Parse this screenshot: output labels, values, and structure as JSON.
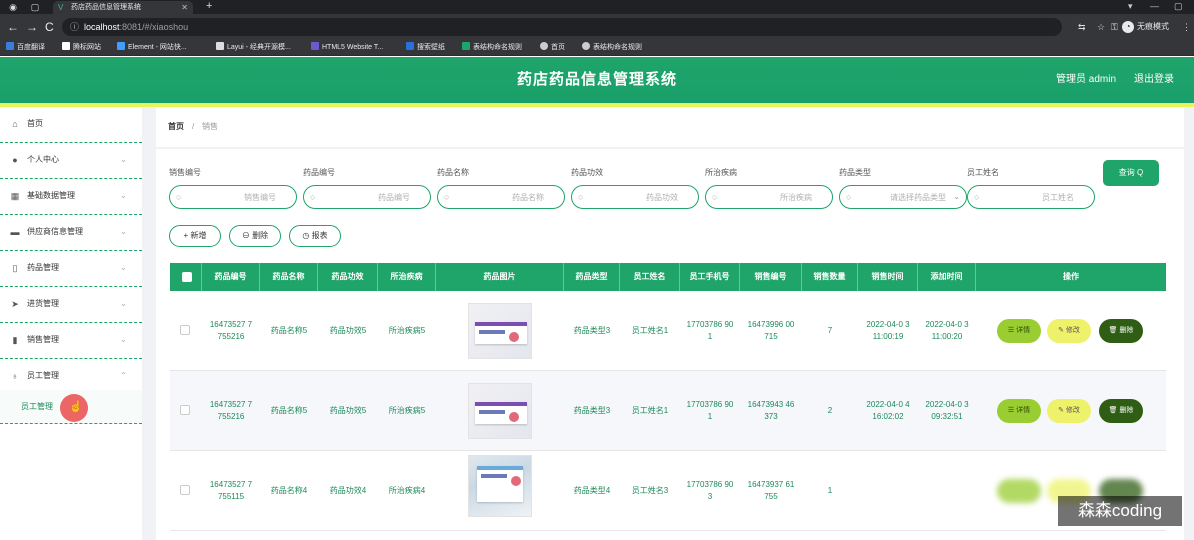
{
  "browser": {
    "tab_title": "药店药品信息管理系统",
    "url_host": "localhost",
    "url_path": ":8081/#/xiaoshou",
    "profile_label": "无痕模式",
    "bookmarks": [
      {
        "label": "百度翻译",
        "color": "#3b7ddd"
      },
      {
        "label": "腾标网站",
        "color": "#ffffff"
      },
      {
        "label": "Element - 网站快...",
        "color": "#409eff"
      },
      {
        "label": "Layui - 经典开源模...",
        "color": "#dddddd"
      },
      {
        "label": "HTML5 Website T...",
        "color": "#6a5acd"
      },
      {
        "label": "搜索壁纸",
        "color": "#2a6fdb"
      },
      {
        "label": "表结构命名规则",
        "color": "#1fa46a"
      },
      {
        "label": "首页",
        "color": "#cccccc"
      },
      {
        "label": "表结构命名规则",
        "color": "#cccccc"
      }
    ]
  },
  "header": {
    "title": "药店药品信息管理系统",
    "admin": "管理员 admin",
    "logout": "退出登录",
    "accent": "#1fa46a",
    "stripe": "#e9f45a"
  },
  "sidebar": {
    "items": [
      {
        "label": "首页",
        "icon": "home-icon"
      },
      {
        "label": "个人中心",
        "icon": "user-icon"
      },
      {
        "label": "基础数据管理",
        "icon": "grid-icon"
      },
      {
        "label": "供应商信息管理",
        "icon": "monitor-icon"
      },
      {
        "label": "药品管理",
        "icon": "phone-icon"
      },
      {
        "label": "进货管理",
        "icon": "send-icon"
      },
      {
        "label": "销售管理",
        "icon": "chart-icon"
      },
      {
        "label": "员工管理",
        "icon": "mic-icon"
      }
    ],
    "submenu_label": "员工管理"
  },
  "breadcrumb": {
    "home": "首页",
    "sep": "/",
    "current": "销售"
  },
  "search": {
    "fields": [
      {
        "label": "销售编号",
        "placeholder": "销售编号"
      },
      {
        "label": "药品编号",
        "placeholder": "药品编号"
      },
      {
        "label": "药品名称",
        "placeholder": "药品名称"
      },
      {
        "label": "药品功效",
        "placeholder": "药品功效"
      },
      {
        "label": "所治疾病",
        "placeholder": "所治疾病"
      },
      {
        "label": "药品类型",
        "placeholder": "请选择药品类型"
      },
      {
        "label": "员工姓名",
        "placeholder": "员工姓名"
      }
    ],
    "query_label": "查询 Q"
  },
  "actions": {
    "add": "+ 新增",
    "delete": "⊖ 删除",
    "report": "◷ 报表"
  },
  "table": {
    "headers": [
      "药品编号",
      "药品名称",
      "药品功效",
      "所治疾病",
      "药品图片",
      "药品类型",
      "员工姓名",
      "员工手机号",
      "销售编号",
      "销售数量",
      "销售时间",
      "添加时间",
      "操作"
    ],
    "rows": [
      {
        "code": "16473527 7755216",
        "name": "药品名称5",
        "effect": "药品功效5",
        "disease": "所治疾病5",
        "type": "药品类型3",
        "staff": "员工姓名1",
        "phone": "17703786 901",
        "sale_no": "16473996 00715",
        "qty": "7",
        "sale_time": "2022-04-0 3 11:00:19",
        "add_time": "2022-04-0 3 11:00:20"
      },
      {
        "code": "16473527 7755216",
        "name": "药品名称5",
        "effect": "药品功效5",
        "disease": "所治疾病5",
        "type": "药品类型3",
        "staff": "员工姓名1",
        "phone": "17703786 901",
        "sale_no": "16473943 46373",
        "qty": "2",
        "sale_time": "2022-04-0 4 16:02:02",
        "add_time": "2022-04-0 3 09:32:51"
      },
      {
        "code": "16473527 7755115",
        "name": "药品名称4",
        "effect": "药品功效4",
        "disease": "所治疾病4",
        "type": "药品类型4",
        "staff": "员工姓名3",
        "phone": "17703786 903",
        "sale_no": "16473937 61755",
        "qty": "1",
        "sale_time": "",
        "add_time": ""
      }
    ],
    "op_detail": "☰ 详情",
    "op_edit": "✎ 修改",
    "op_delete": "🗑 删除"
  },
  "watermark": "森森coding"
}
